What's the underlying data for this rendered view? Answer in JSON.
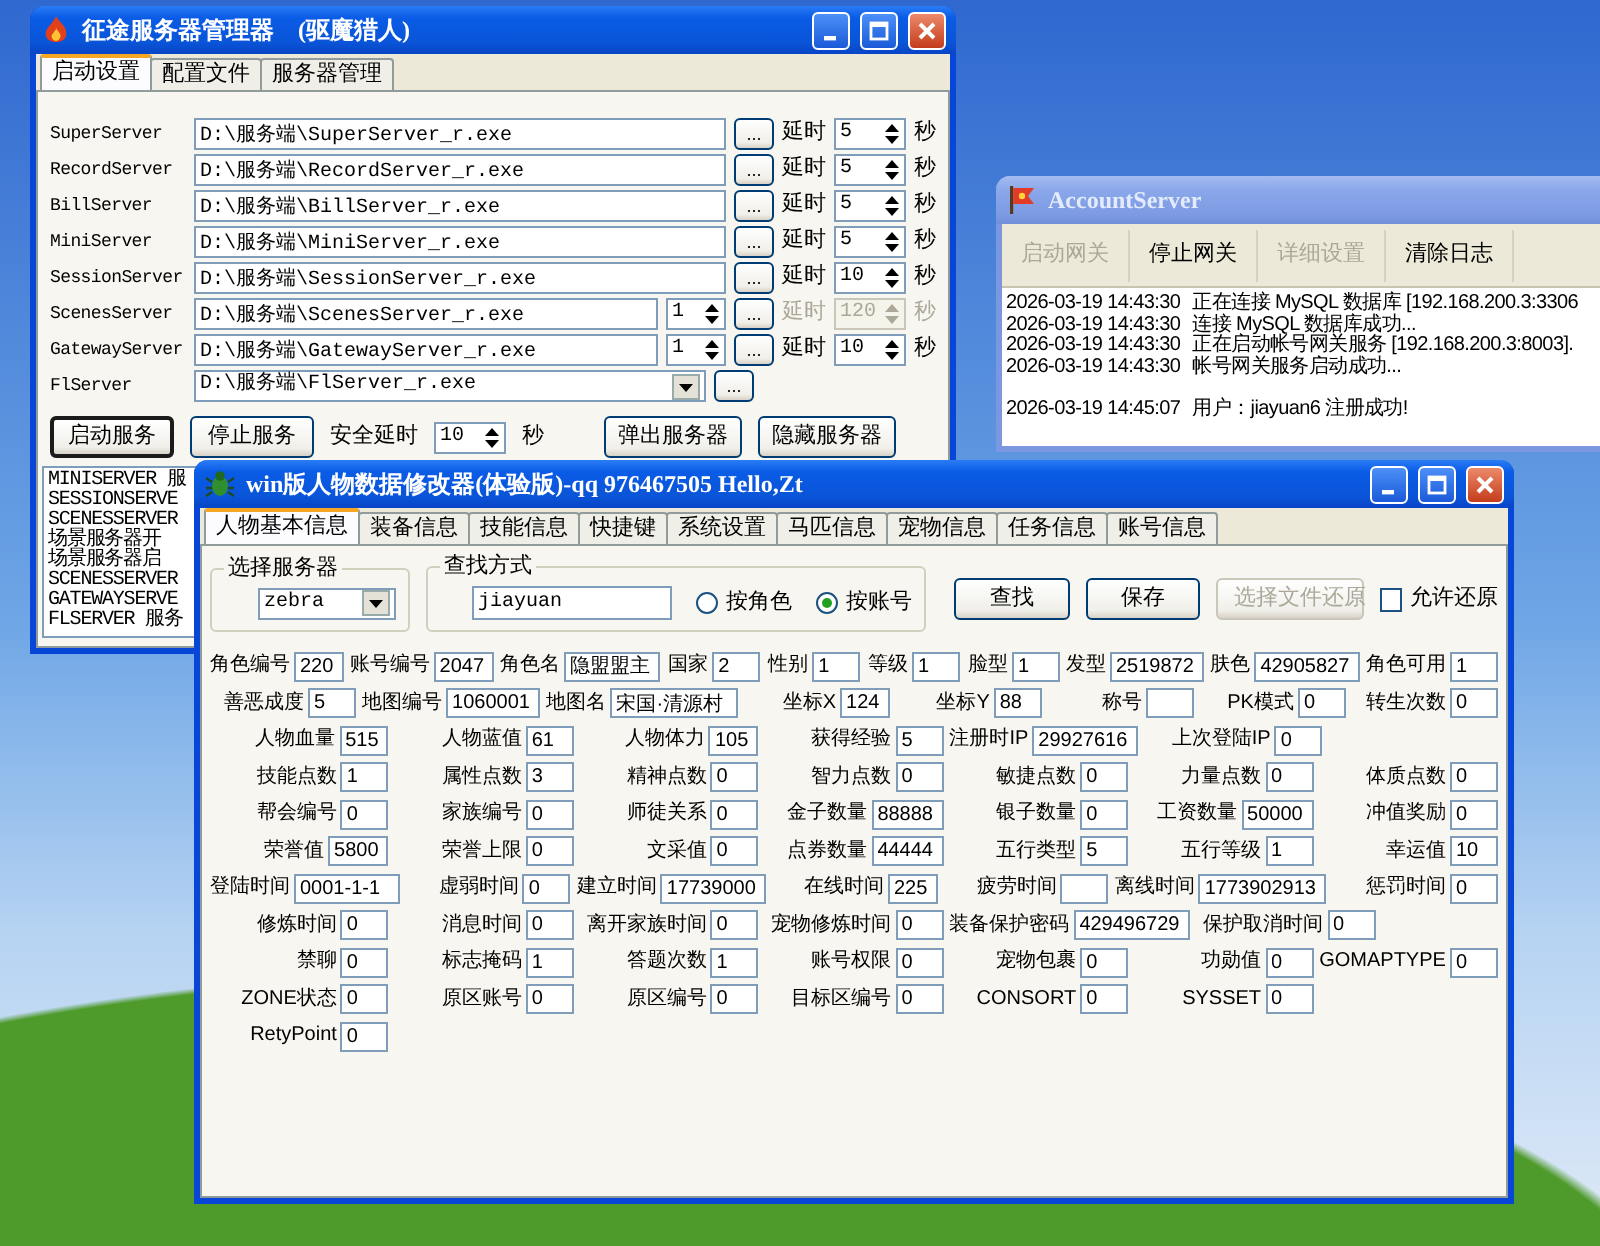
{
  "server_manager": {
    "title": "征途服务器管理器　(驱魔猎人)",
    "tabs": [
      {
        "label": "启动设置",
        "selected": true
      },
      {
        "label": "配置文件",
        "selected": false
      },
      {
        "label": "服务器管理",
        "selected": false
      }
    ],
    "servers": [
      {
        "kind": "exe",
        "name": "SuperServer",
        "path": "D:\\服务端\\SuperServer_r.exe",
        "browse": "...",
        "delay_label": "延时",
        "delay": "5",
        "unit": "秒",
        "delay_disabled": false
      },
      {
        "kind": "exe",
        "name": "RecordServer",
        "path": "D:\\服务端\\RecordServer_r.exe",
        "browse": "...",
        "delay_label": "延时",
        "delay": "5",
        "unit": "秒",
        "delay_disabled": false
      },
      {
        "kind": "exe",
        "name": "BillServer",
        "path": "D:\\服务端\\BillServer_r.exe",
        "browse": "...",
        "delay_label": "延时",
        "delay": "5",
        "unit": "秒",
        "delay_disabled": false
      },
      {
        "kind": "exe",
        "name": "MiniServer",
        "path": "D:\\服务端\\MiniServer_r.exe",
        "browse": "...",
        "delay_label": "延时",
        "delay": "5",
        "unit": "秒",
        "delay_disabled": false
      },
      {
        "kind": "exe",
        "name": "SessionServer",
        "path": "D:\\服务端\\SessionServer_r.exe",
        "browse": "...",
        "delay_label": "延时",
        "delay": "10",
        "unit": "秒",
        "delay_disabled": false
      },
      {
        "kind": "exe",
        "name": "ScenesServer",
        "path": "D:\\服务端\\ScenesServer_r.exe",
        "instances": "1",
        "browse": "...",
        "delay_label": "延时",
        "delay": "120",
        "unit": "秒",
        "delay_disabled": true
      },
      {
        "kind": "exe",
        "name": "GatewayServer",
        "path": "D:\\服务端\\GatewayServer_r.exe",
        "instances": "1",
        "browse": "...",
        "delay_label": "延时",
        "delay": "10",
        "unit": "秒",
        "delay_disabled": false
      },
      {
        "kind": "combo",
        "name": "FlServer",
        "path": "D:\\服务端\\FlServer_r.exe",
        "browse": "..."
      }
    ],
    "buttons_left": [
      {
        "label": "启动服务",
        "default": true
      },
      {
        "label": "停止服务",
        "default": false
      }
    ],
    "safe_delay": {
      "label": "安全延时",
      "value": "10",
      "unit": "秒"
    },
    "buttons_right": [
      {
        "label": "弹出服务器",
        "default": false
      },
      {
        "label": "隐藏服务器",
        "default": false
      }
    ],
    "log": [
      "MINISERVER 服",
      "SESSIONSERVE",
      "SCENESSERVER",
      "场景服务器开",
      "场景服务器启",
      "SCENESSERVER",
      "GATEWAYSERVE",
      "FLSERVER 服务"
    ]
  },
  "account_server": {
    "title": "AccountServer",
    "toolbar": [
      {
        "label": "启动网关",
        "disabled": true
      },
      {
        "label": "停止网关",
        "disabled": false
      },
      {
        "label": "详细设置",
        "disabled": true
      },
      {
        "label": "清除日志",
        "disabled": false
      }
    ],
    "log": [
      {
        "time": "2026-03-19 14:43:30",
        "message": "正在连接 MySQL 数据库 [192.168.200.3:3306",
        "gap_before": false
      },
      {
        "time": "2026-03-19 14:43:30",
        "message": "连接 MySQL 数据库成功...",
        "gap_before": false
      },
      {
        "time": "2026-03-19 14:43:30",
        "message": "正在启动帐号网关服务 [192.168.200.3:8003].",
        "gap_before": false
      },
      {
        "time": "2026-03-19 14:43:30",
        "message": "帐号网关服务启动成功...",
        "gap_before": false
      },
      {
        "time": "2026-03-19 14:45:07",
        "message": "用户：jiayuan6 注册成功!",
        "gap_before": true
      }
    ]
  },
  "editor": {
    "title": "win版人物数据修改器(体验版)-qq 976467505 Hello,Zt",
    "tabs": [
      {
        "label": "人物基本信息",
        "selected": true
      },
      {
        "label": "装备信息",
        "selected": false
      },
      {
        "label": "技能信息",
        "selected": false
      },
      {
        "label": "快捷键",
        "selected": false
      },
      {
        "label": "系统设置",
        "selected": false
      },
      {
        "label": "马匹信息",
        "selected": false
      },
      {
        "label": "宠物信息",
        "selected": false
      },
      {
        "label": "任务信息",
        "selected": false
      },
      {
        "label": "账号信息",
        "selected": false
      }
    ],
    "server_group": {
      "legend": "选择服务器",
      "value": "zebra"
    },
    "search_group": {
      "legend": "查找方式",
      "value": "jiayuan",
      "options": [
        {
          "label": "按角色",
          "selected": false
        },
        {
          "label": "按账号",
          "selected": true
        }
      ]
    },
    "buttons": [
      {
        "label": "查找",
        "disabled": false
      },
      {
        "label": "保存",
        "disabled": false
      },
      {
        "label": "选择文件还原",
        "disabled": true
      }
    ],
    "allow_restore": {
      "label": "允许还原",
      "checked": false
    },
    "field_rows": [
      [
        {
          "label": "角色编号",
          "value": "220"
        },
        {
          "label": "账号编号",
          "value": "2047"
        },
        {
          "label": "角色名",
          "value": "隐盟盟主"
        },
        {
          "label": "国家",
          "value": "2"
        },
        {
          "label": "性别",
          "value": "1"
        },
        {
          "label": "等级",
          "value": "1"
        },
        {
          "label": "脸型",
          "value": "1"
        },
        {
          "label": "发型",
          "value": "2519872"
        },
        {
          "label": "肤色",
          "value": "42905827"
        },
        {
          "label": "角色可用",
          "value": "1"
        }
      ],
      [
        {
          "label": "善恶成度",
          "value": "5"
        },
        {
          "label": "地图编号",
          "value": "1060001"
        },
        {
          "label": "地图名",
          "value": "宋国·清源村"
        },
        {
          "label": "坐标X",
          "value": "124"
        },
        {
          "label": "坐标Y",
          "value": "88"
        },
        {
          "label": "称号"
        },
        {
          "label": "PK模式",
          "value": "0"
        },
        {
          "label": "转生次数",
          "value": "0"
        }
      ],
      [
        {
          "label": "人物血量",
          "value": "515"
        },
        {
          "label": "人物蓝值",
          "value": "61"
        },
        {
          "label": "人物体力",
          "value": "105"
        },
        {
          "label": "获得经验",
          "value": "5"
        },
        {
          "label": "注册时IP",
          "value": "29927616"
        },
        {
          "label": "上次登陆IP",
          "value": "0"
        }
      ],
      [
        {
          "label": "技能点数",
          "value": "1"
        },
        {
          "label": "属性点数",
          "value": "3"
        },
        {
          "label": "精神点数",
          "value": "0"
        },
        {
          "label": "智力点数",
          "value": "0"
        },
        {
          "label": "敏捷点数",
          "value": "0"
        },
        {
          "label": "力量点数",
          "value": "0"
        },
        {
          "label": "体质点数",
          "value": "0"
        }
      ],
      [
        {
          "label": "帮会编号",
          "value": "0"
        },
        {
          "label": "家族编号",
          "value": "0"
        },
        {
          "label": "师徒关系",
          "value": "0"
        },
        {
          "label": "金子数量",
          "value": "88888"
        },
        {
          "label": "银子数量",
          "value": "0"
        },
        {
          "label": "工资数量",
          "value": "50000"
        },
        {
          "label": "冲值奖励",
          "value": "0"
        }
      ],
      [
        {
          "label": "荣誉值",
          "value": "5800"
        },
        {
          "label": "荣誉上限",
          "value": "0"
        },
        {
          "label": "文采值",
          "value": "0"
        },
        {
          "label": "点券数量",
          "value": "44444"
        },
        {
          "label": "五行类型",
          "value": "5"
        },
        {
          "label": "五行等级",
          "value": "1"
        },
        {
          "label": "幸运值",
          "value": "10"
        }
      ],
      [
        {
          "label": "登陆时间",
          "value": "0001-1-1"
        },
        {
          "label": "虚弱时间",
          "value": "0"
        },
        {
          "label": "建立时间",
          "value": "17739000"
        },
        {
          "label": "在线时间",
          "value": "225"
        },
        {
          "label": "疲劳时间"
        },
        {
          "label": "离线时间",
          "value": "1773902913"
        },
        {
          "label": "惩罚时间",
          "value": "0"
        }
      ],
      [
        {
          "label": "修炼时间",
          "value": "0"
        },
        {
          "label": "消息时间",
          "value": "0"
        },
        {
          "label": "离开家族时间",
          "value": "0"
        },
        {
          "label": "宠物修炼时间",
          "value": "0"
        },
        {
          "label": "装备保护密码",
          "value": "429496729"
        },
        {
          "label": "保护取消时间",
          "value": "0"
        }
      ],
      [
        {
          "label": "禁聊",
          "value": "0"
        },
        {
          "label": "标志掩码",
          "value": "1"
        },
        {
          "label": "答题次数",
          "value": "1"
        },
        {
          "label": "账号权限",
          "value": "0"
        },
        {
          "label": "宠物包裹",
          "value": "0"
        },
        {
          "label": "功勋值",
          "value": "0"
        },
        {
          "label": "GOMAPTYPE",
          "value": "0"
        }
      ],
      [
        {
          "label": "ZONE状态",
          "value": "0"
        },
        {
          "label": "原区账号",
          "value": "0"
        },
        {
          "label": "原区编号",
          "value": "0"
        },
        {
          "label": "目标区编号",
          "value": "0"
        },
        {
          "label": "CONSORT",
          "value": "0"
        },
        {
          "label": "SYSSET",
          "value": "0"
        }
      ],
      [
        {
          "label": "RetyPoint",
          "value": "0"
        }
      ]
    ]
  }
}
